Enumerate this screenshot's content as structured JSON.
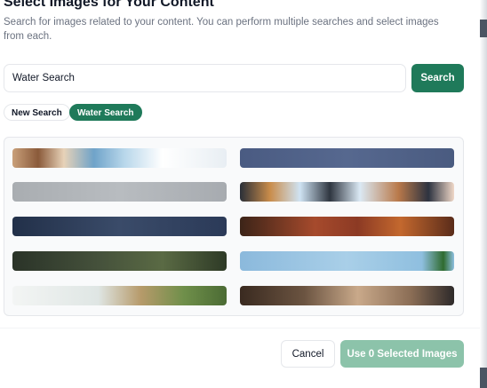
{
  "dialog": {
    "title": "Select Images for Your Content",
    "subtitle": "Search for images related to your content. You can perform multiple searches and select images from each."
  },
  "search": {
    "value": "Water Search",
    "placeholder": "",
    "button_label": "Search"
  },
  "chips": [
    {
      "label": "New Search",
      "active": false
    },
    {
      "label": "Water Search",
      "active": true
    }
  ],
  "footer": {
    "cancel_label": "Cancel",
    "use_label": "Use 0 Selected Images"
  },
  "colors": {
    "accent": "#1f7a5a",
    "accent_disabled": "#8cc3aa"
  }
}
